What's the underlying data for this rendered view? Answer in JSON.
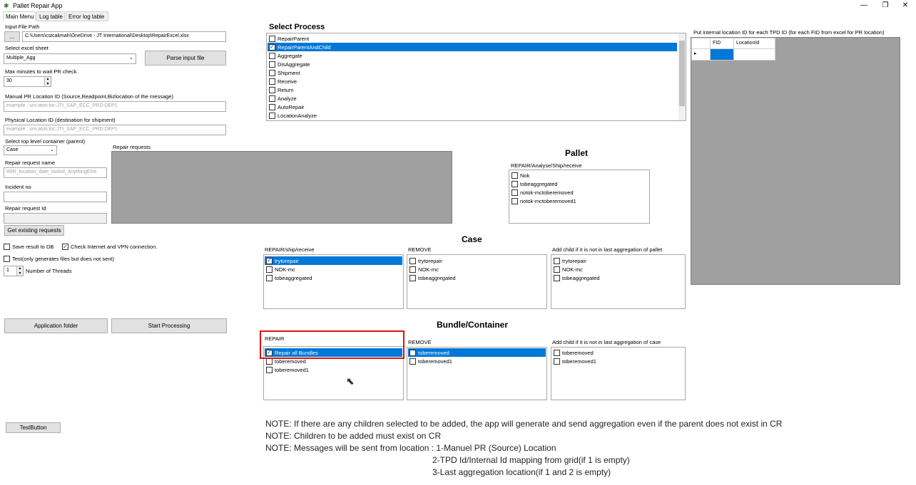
{
  "window": {
    "title": "Pallet Repair App",
    "icon": "app-icon",
    "minimize": "—",
    "restore": "❐",
    "close": "✕"
  },
  "tabs": [
    "Main Menu",
    "Log table",
    "Error log table"
  ],
  "left": {
    "input_file_label": "Input File Path",
    "browse_label": "...",
    "input_file_value": "C:\\Users\\cstcakmah\\OneDrive - JT International\\Desktop\\RepairExcel.xlsx",
    "sheet_label": "Select excel sheet",
    "sheet_value": "Multiple_Agg",
    "parse_label": "Parse input file",
    "max_minutes_label": "Max minutes to wait PR check",
    "max_minutes_value": "30",
    "manual_pr_label": "Manual PR Location ID (Source,Readpoint,Bizlocation of the message)",
    "manual_pr_placeholder": "example : urn:atos:loc:JTI_SAP_ECC_PRD:DEP1",
    "physical_label": "Physical Location ID (destination for shipment)",
    "physical_placeholder": "example : urn:atos:loc:JTI_SAP_ECC_PRD:DEP1",
    "top_container_label": "Select top level container (parent)",
    "top_container_value": "Case",
    "repair_name_label": "Repair request name",
    "repair_name_placeholder": "WIR_location_date_taskId_AnythingElse",
    "incident_label": "Incident no",
    "repair_id_label": "Repair request Id",
    "get_existing_label": "Get existing requests",
    "repair_requests_label": "Repair requests",
    "save_db_label": "Save result to DB",
    "check_internet_label": "Check Internet and VPN connection.",
    "test_label": "Test(only generates files but does not sent)",
    "threads_value": "1",
    "threads_label": "Number of Threads",
    "app_folder_label": "Application folder",
    "start_label": "Start Processing",
    "test_button_label": "TestButton"
  },
  "process": {
    "title": "Select Process",
    "items": [
      {
        "label": "RepairParent",
        "checked": false,
        "selected": false
      },
      {
        "label": "RepairParentAndChild",
        "checked": true,
        "selected": true
      },
      {
        "label": "Aggregate",
        "checked": false,
        "selected": false
      },
      {
        "label": "DisAggregate",
        "checked": false,
        "selected": false
      },
      {
        "label": "Shipment",
        "checked": false,
        "selected": false
      },
      {
        "label": "Receive",
        "checked": false,
        "selected": false
      },
      {
        "label": "Return",
        "checked": false,
        "selected": false
      },
      {
        "label": "Analyze",
        "checked": false,
        "selected": false
      },
      {
        "label": "AutoRepair",
        "checked": false,
        "selected": false
      },
      {
        "label": "LocationAnalyze",
        "checked": false,
        "selected": false
      }
    ]
  },
  "pallet": {
    "title": "Pallet",
    "subtitle": "REPAIR/Analyse/Ship/receive",
    "items": [
      {
        "label": "Nok",
        "checked": false
      },
      {
        "label": "tobeaggregated",
        "checked": false
      },
      {
        "label": "notok-mctoberemoved",
        "checked": false
      },
      {
        "label": "notok-mctoberemoved1",
        "checked": false
      }
    ]
  },
  "case": {
    "title": "Case",
    "repair": {
      "label": "REPAIR/ship/receive",
      "items": [
        {
          "label": "trytorepair",
          "checked": true,
          "selected": true
        },
        {
          "label": "NOK-mc",
          "checked": false,
          "selected": false
        },
        {
          "label": "tobeaggregated",
          "checked": false,
          "selected": false
        }
      ]
    },
    "remove": {
      "label": "REMOVE",
      "items": [
        {
          "label": "trytorepair",
          "checked": false
        },
        {
          "label": "NOK-mc",
          "checked": false
        },
        {
          "label": "tobeaggregated",
          "checked": false
        }
      ]
    },
    "add_child": {
      "label": "Add child if it is not in last aggregation of pallet",
      "items": [
        {
          "label": "trytorepair",
          "checked": false
        },
        {
          "label": "NOK-mc",
          "checked": false
        },
        {
          "label": "tobeaggregated",
          "checked": false
        }
      ]
    }
  },
  "bundle": {
    "title": "Bundle/Container",
    "repair": {
      "label": "REPAIR",
      "items": [
        {
          "label": "Repair all Bundles",
          "checked": true,
          "selected": true
        },
        {
          "label": "toberemoved",
          "checked": false,
          "selected": false
        },
        {
          "label": "toberemoved1",
          "checked": false,
          "selected": false
        }
      ]
    },
    "remove": {
      "label": "REMOVE",
      "items": [
        {
          "label": "toberemoved",
          "checked": false,
          "selected": true
        },
        {
          "label": "toberemoved1",
          "checked": false,
          "selected": false
        }
      ]
    },
    "add_child": {
      "label": "Add child if it is not in last aggregation of case",
      "items": [
        {
          "label": "toberemoved",
          "checked": false
        },
        {
          "label": "toberemoved1",
          "checked": false
        }
      ]
    }
  },
  "grid": {
    "title": "Put internal location ID for each TPD ID (for each FID from excel for PR location)",
    "columns": [
      "FID",
      "LocationId"
    ],
    "row_indicator": "▸"
  },
  "notes": [
    "NOTE: If there are any children selected to be added, the app will generate and send aggregation even if the parent does not exist in CR",
    "NOTE: Children to be added must exist on CR",
    "NOTE: Messages will be sent from location : 1-Manuel PR (Source) Location",
    "2-TPD Id/Internal Id mapping from grid(if 1 is empty)",
    "3-Last aggregation location(if 1 and 2 is empty)"
  ]
}
